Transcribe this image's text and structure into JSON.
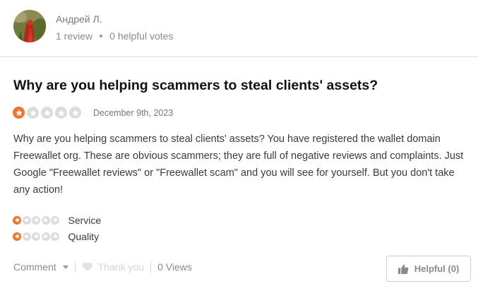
{
  "reviewer": {
    "name": "Андрей Л.",
    "reviews": "1 review",
    "helpful_votes": "0 helpful votes"
  },
  "review": {
    "title": "Why are you helping scammers to steal clients' assets?",
    "rating": 1,
    "max_rating": 5,
    "date": "December 9th, 2023",
    "body": "Why are you helping scammers to steal clients' assets? You have registered the wallet domain Freewallet org. These are obvious scammers; they are full of negative reviews and complaints. Just Google \"Freewallet reviews\" or \"Freewallet scam\" and you will see for yourself. But you don't take any action!"
  },
  "sub_ratings": [
    {
      "label": "Service",
      "rating": 1
    },
    {
      "label": "Quality",
      "rating": 1
    }
  ],
  "actions": {
    "comment": "Comment",
    "thank_you": "Thank you",
    "views": "0 Views",
    "helpful": "Helpful (0)"
  },
  "colors": {
    "star_active": "#f0742a",
    "star_inactive": "#dcdcdc",
    "title": "#111111",
    "muted": "#8a8a8a"
  }
}
